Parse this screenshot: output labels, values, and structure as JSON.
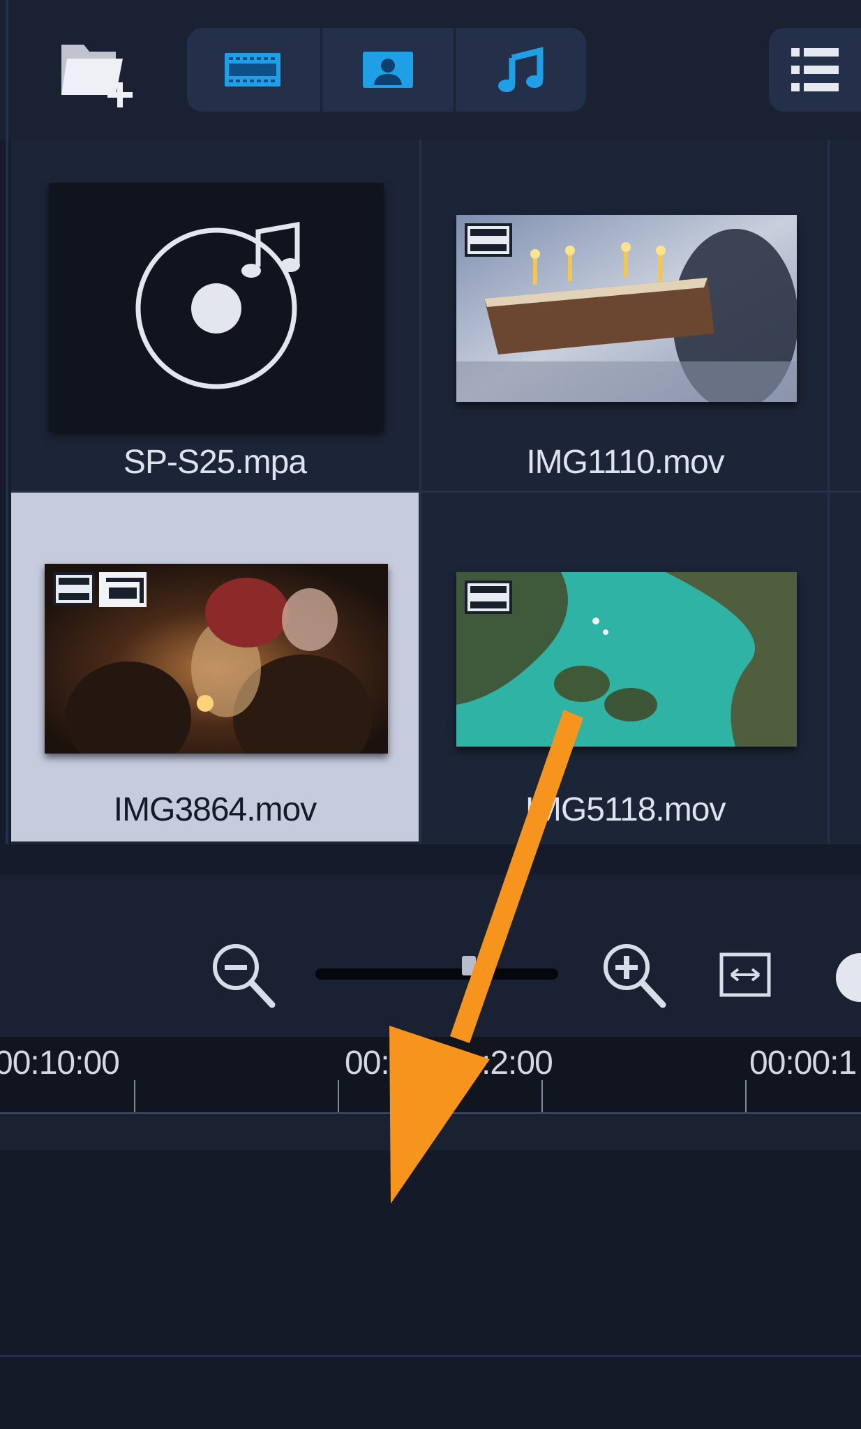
{
  "toolbar": {
    "import_icon": "folder-add-icon",
    "filters": [
      {
        "icon": "film-icon",
        "color": "#1fa0e6"
      },
      {
        "icon": "photo-icon",
        "color": "#1fa0e6"
      },
      {
        "icon": "music-note-icon",
        "color": "#1fa0e6"
      }
    ],
    "list_view_icon": "list-view-icon"
  },
  "media": {
    "items": [
      {
        "name": "SP-S25.mpa",
        "type": "audio",
        "badges": []
      },
      {
        "name": "IMG1110.mov",
        "type": "video",
        "badges": [
          "film-icon"
        ]
      },
      {
        "name": "IMG3864.mov",
        "type": "video",
        "badges": [
          "film-icon",
          "subtitle-icon"
        ],
        "selected": true
      },
      {
        "name": "IMG5118.mov",
        "type": "video",
        "badges": [
          "film-icon"
        ]
      }
    ]
  },
  "timeline": {
    "zoom_out_icon": "zoom-out-icon",
    "zoom_in_icon": "zoom-in-icon",
    "fit_icon": "fit-to-window-icon",
    "ticks": [
      "00:10:00",
      "00:00:12:00",
      "00:00:1"
    ],
    "tick_display": [
      "00:10:00",
      "00:0",
      ":2:00",
      "00:00:1"
    ]
  },
  "overlay": {
    "arrow_color": "#f7941d"
  }
}
